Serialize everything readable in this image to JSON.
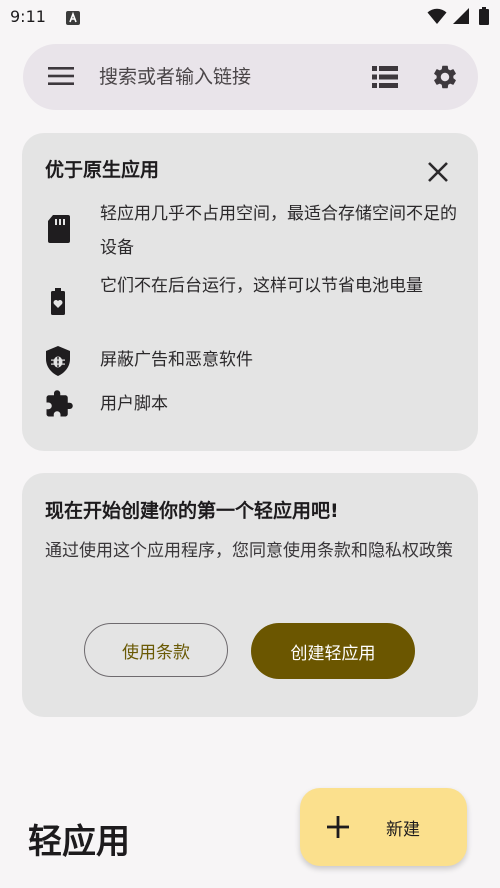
{
  "status_bar": {
    "time": "9:11",
    "notification_icon": "store-notification-icon",
    "wifi_icon": "wifi-icon",
    "signal_icon": "cell-signal-icon",
    "battery_icon": "battery-icon"
  },
  "search": {
    "placeholder": "搜索或者输入链接",
    "menu_icon": "hamburger-menu-icon",
    "list_icon": "list-view-icon",
    "settings_icon": "gear-icon"
  },
  "intro_card": {
    "title": "优于原生应用",
    "close_icon": "close-icon",
    "features": [
      {
        "icon": "sd-card-icon",
        "text": "轻应用几乎不占用空间，最适合存储空间不足的设备"
      },
      {
        "icon": "battery-heart-icon",
        "text": "它们不在后台运行，这样可以节省电池电量"
      },
      {
        "icon": "shield-bug-icon",
        "text": "屏蔽广告和恶意软件"
      },
      {
        "icon": "puzzle-piece-icon",
        "text": "用户脚本"
      }
    ]
  },
  "start_card": {
    "title": "现在开始创建你的第一个轻应用吧!",
    "description": "通过使用这个应用程序，您同意使用条款和隐私权政策",
    "terms_button": "使用条款",
    "create_button": "创建轻应用"
  },
  "fab": {
    "icon": "plus-icon",
    "label": "新建"
  },
  "page_heading": "轻应用",
  "colors": {
    "background": "#f7f5f6",
    "search_bar": "#e9e4ea",
    "card": "#e4e4e4",
    "primary": "#6b5600",
    "fab": "#fbe08d",
    "terms_text": "#6a5a05"
  }
}
